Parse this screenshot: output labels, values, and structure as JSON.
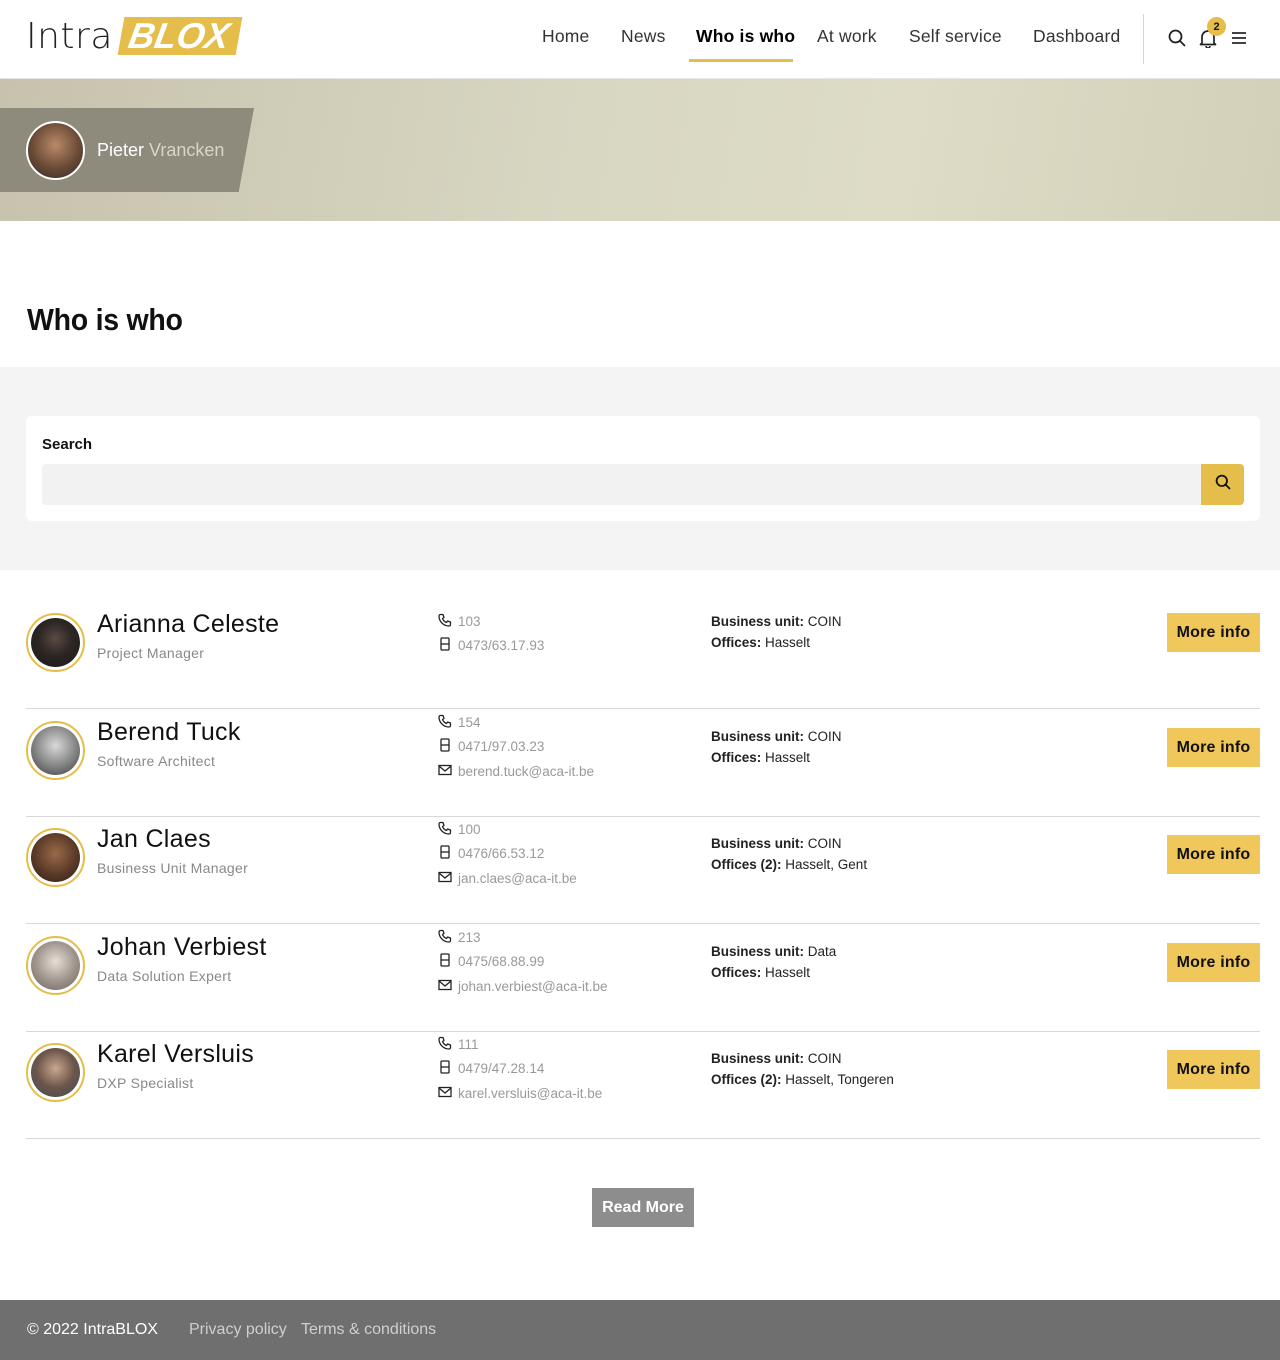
{
  "logo": {
    "part1": "Intra",
    "part2": "BLOX"
  },
  "nav": {
    "items": [
      "Home",
      "News",
      "Who is who",
      "At work",
      "Self service",
      "Dashboard"
    ],
    "active": "Who is who"
  },
  "notifications": {
    "count": "2"
  },
  "hero": {
    "first_name": "Pieter",
    "last_name": "Vrancken"
  },
  "page": {
    "title": "Who is who"
  },
  "search": {
    "label": "Search",
    "value": "",
    "placeholder": ""
  },
  "people": [
    {
      "name": "Arianna Celeste",
      "role": "Project Manager",
      "phone": "103",
      "mobile": "0473/63.17.93",
      "email": "",
      "business_unit": "COIN",
      "offices_label": "Offices:",
      "offices": "Hasselt",
      "button": "More info"
    },
    {
      "name": "Berend Tuck",
      "role": "Software Architect",
      "phone": "154",
      "mobile": "0471/97.03.23",
      "email": "berend.tuck@aca-it.be",
      "business_unit": "COIN",
      "offices_label": "Offices:",
      "offices": "Hasselt",
      "button": "More info"
    },
    {
      "name": "Jan Claes",
      "role": "Business Unit Manager",
      "phone": "100",
      "mobile": "0476/66.53.12",
      "email": "jan.claes@aca-it.be",
      "business_unit": "COIN",
      "offices_label": "Offices (2):",
      "offices": "Hasselt, Gent",
      "button": "More info"
    },
    {
      "name": "Johan Verbiest",
      "role": "Data Solution Expert",
      "phone": "213",
      "mobile": "0475/68.88.99",
      "email": "johan.verbiest@aca-it.be",
      "business_unit": "Data",
      "offices_label": "Offices:",
      "offices": "Hasselt",
      "button": "More info"
    },
    {
      "name": "Karel Versluis",
      "role": "DXP Specialist",
      "phone": "111",
      "mobile": "0479/47.28.14",
      "email": "karel.versluis@aca-it.be",
      "business_unit": "COIN",
      "offices_label": "Offices (2):",
      "offices": "Hasselt, Tongeren",
      "button": "More info"
    }
  ],
  "labels": {
    "business_unit": "Business unit:"
  },
  "read_more": "Read More",
  "footer": {
    "copyright": "© 2022 IntraBLOX",
    "privacy": "Privacy policy",
    "terms": "Terms & conditions"
  },
  "colors": {
    "accent": "#e5bd4a",
    "footer_bg": "#6f6f6f",
    "read_more_bg": "#8d8d8d"
  },
  "icons": {
    "search": "search-icon",
    "notifications": "bell-icon",
    "menu": "hamburger-icon",
    "phone": "phone-icon",
    "mobile": "mobile-icon",
    "email": "envelope-icon"
  }
}
